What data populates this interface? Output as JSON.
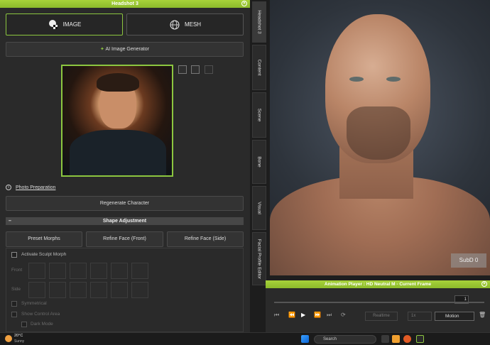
{
  "window": {
    "title": "Headshot 3"
  },
  "mode_tabs": [
    {
      "label": "IMAGE",
      "icon": "image-face-icon",
      "active": true
    },
    {
      "label": "MESH",
      "icon": "mesh-sphere-icon",
      "active": false
    }
  ],
  "ai_button": {
    "label": "AI Image Generator",
    "icon": "sparkle-icon"
  },
  "photo_tools": [
    "folder-open-icon",
    "save-icon",
    "clear-icon"
  ],
  "photo_prep": {
    "label": "Photo Preparation"
  },
  "regenerate_button": {
    "label": "Regenerate Character"
  },
  "shape_adjustment": {
    "title": "Shape Adjustment",
    "buttons": [
      "Preset Morphs",
      "Refine Face (Front)",
      "Refine Face (Side)"
    ]
  },
  "sculpt": {
    "checkbox_label": "Activate Sculpt Morph",
    "front_label": "Front",
    "side_label": "Side",
    "options": [
      "Symmetrical",
      "Show Control Area",
      "Dark Mode"
    ]
  },
  "side_tabs": [
    "Headshot 3",
    "Content",
    "Scene",
    "Bone",
    "Visual",
    "Facial Profile Editor"
  ],
  "viewport": {
    "subd_label": "SubD 0"
  },
  "animation_player": {
    "title": "Animation Player : HD Neutral M - Current Frame",
    "frame_value": "1",
    "realtime_label": "Realtime",
    "speed_label": "1x",
    "motion_label": "Motion"
  },
  "taskbar": {
    "weather_temp": "20°C",
    "weather_desc": "Sunny",
    "search_placeholder": "Search"
  },
  "colors": {
    "accent": "#8cc63f",
    "panel": "#2a2a2a"
  }
}
